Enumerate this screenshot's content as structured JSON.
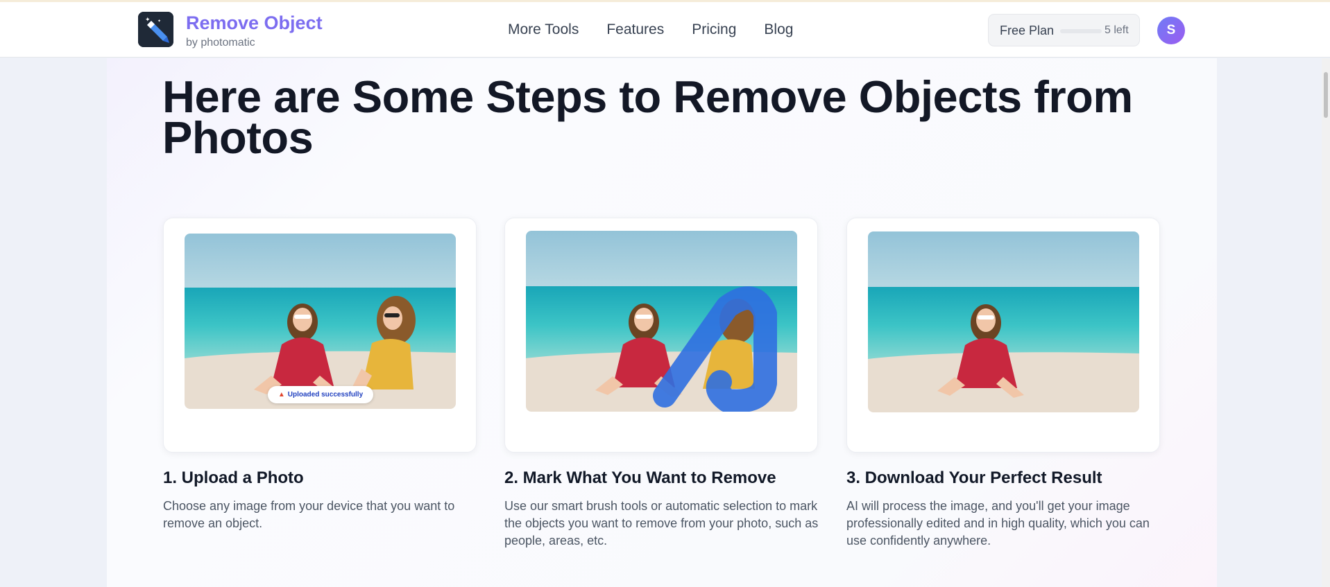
{
  "header": {
    "logo_title": "Remove Object",
    "logo_sub": "by photomatic",
    "nav": [
      "More Tools",
      "Features",
      "Pricing",
      "Blog"
    ],
    "plan_label": "Free Plan",
    "plan_left": "5 left",
    "avatar_initial": "S"
  },
  "main": {
    "heading": "Here are Some Steps to Remove Objects from Photos",
    "steps": [
      {
        "title": "1. Upload a Photo",
        "description": "Choose any image from your device that you want to remove an object.",
        "toast": "Uploaded successfully",
        "toast_icon": "party-popper-icon"
      },
      {
        "title": "2. Mark What You Want to Remove",
        "description": "Use our smart brush tools or automatic selection to mark the objects you want to remove from your photo, such as people, areas, etc."
      },
      {
        "title": "3. Download Your Perfect Result",
        "description": "AI will process the image, and you'll get your image professionally edited and in high quality, which you can use confidently anywhere."
      }
    ]
  },
  "colors": {
    "brand": "#7c6df0",
    "heading": "#131826",
    "brush": "#2f6fe0",
    "sea": "#29b7c4"
  }
}
